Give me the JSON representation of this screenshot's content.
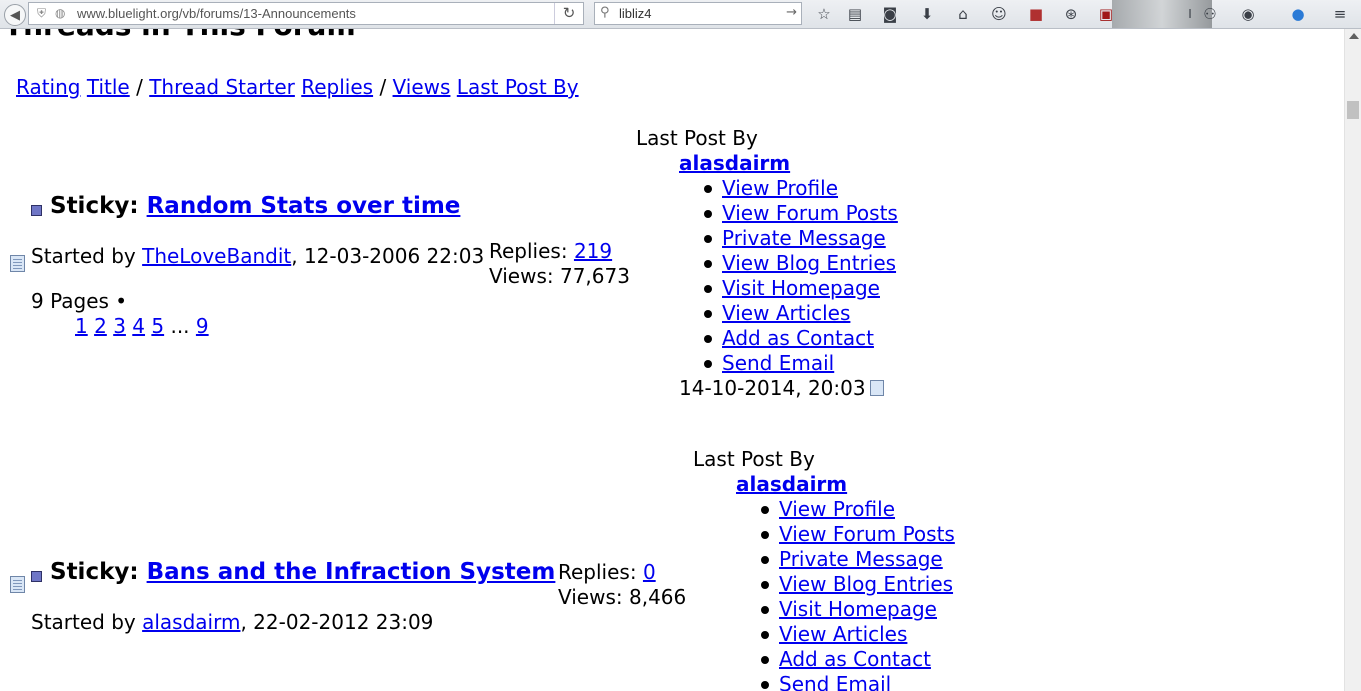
{
  "browser": {
    "url": "www.bluelight.org/vb/forums/13-Announcements",
    "search_query": "libliz4"
  },
  "page": {
    "heading": "Threads in This Forum",
    "sort_links": [
      {
        "label": "Rating"
      },
      {
        "label": "Title"
      },
      {
        "label": "Thread Starter"
      },
      {
        "label": "Replies"
      },
      {
        "label": "Views"
      },
      {
        "label": "Last Post By"
      }
    ],
    "sort_separators": [
      "/",
      "/"
    ]
  },
  "threads": [
    {
      "prefix": "Sticky:",
      "title": "Random Stats over time",
      "started_by_label": "Started by",
      "starter": "TheLoveBandit",
      "start_date": ", 12-03-2006 22:03",
      "replies_label": "Replies:",
      "replies": "219",
      "views_label": "Views:",
      "views": "77,673",
      "pages_label": "9 Pages •",
      "pages": [
        "1",
        "2",
        "3",
        "4",
        "5"
      ],
      "pages_ellipsis": "...",
      "last_page": "9",
      "last_post": {
        "label": "Last Post By",
        "poster": "alasdairm",
        "menu": [
          "View Profile",
          "View Forum Posts",
          "Private Message",
          "View Blog Entries",
          "Visit Homepage",
          "View Articles",
          "Add as Contact",
          "Send Email"
        ],
        "date": "14-10-2014, 20:03"
      }
    },
    {
      "prefix": "Sticky:",
      "title": "Bans and the Infraction System",
      "started_by_label": "Started by",
      "starter": "alasdairm",
      "start_date": ", 22-02-2012 23:09",
      "replies_label": "Replies:",
      "replies": "0",
      "views_label": "Views:",
      "views": "8,466",
      "last_post": {
        "label": "Last Post By",
        "poster": "alasdairm",
        "menu": [
          "View Profile",
          "View Forum Posts",
          "Private Message",
          "View Blog Entries",
          "Visit Homepage",
          "View Articles",
          "Add as Contact",
          "Send Email"
        ]
      }
    }
  ]
}
